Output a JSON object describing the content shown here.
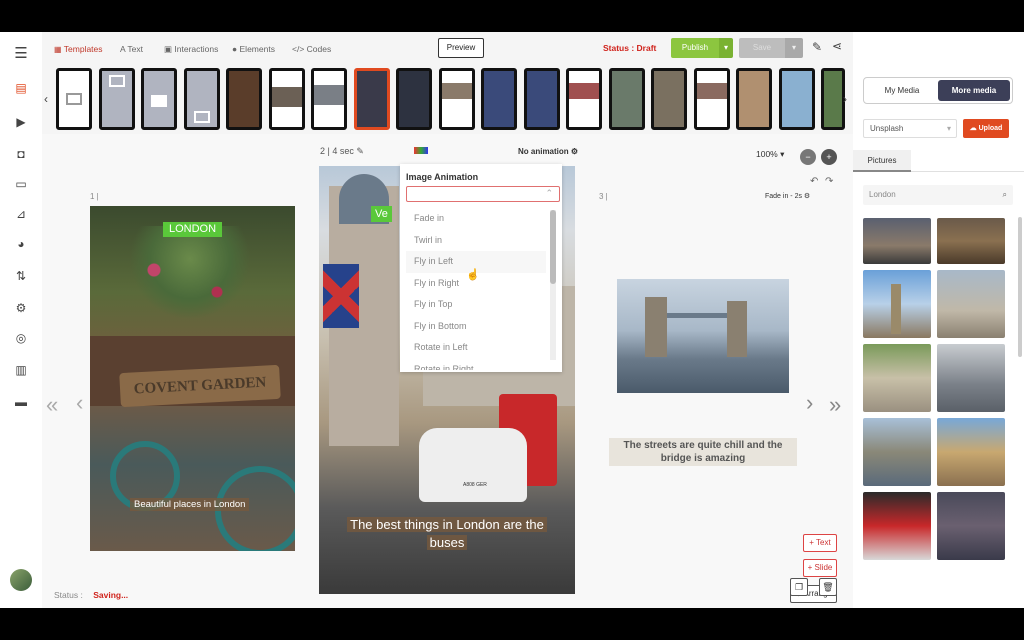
{
  "tabs": {
    "templates": "Templates",
    "text": "Text",
    "interactions": "Interactions",
    "elements": "Elements",
    "codes": "Codes"
  },
  "toolbar": {
    "preview": "Preview",
    "status": "Status : Draft",
    "publish": "Publish",
    "save": "Save"
  },
  "editor": {
    "slide_info": "2 |  4 sec",
    "no_animation": "No animation",
    "zoom": "100%",
    "slide1_num": "1 |",
    "slide3_num": "3 |",
    "slide3_anim": "Fade in - 2s"
  },
  "dropdown": {
    "title": "Image Animation",
    "options": [
      "Fade in",
      "Twirl in",
      "Fly in Left",
      "Fly in Right",
      "Fly in Top",
      "Fly in Bottom",
      "Rotate in Left",
      "Rotate in Right"
    ]
  },
  "slides": {
    "s1_label": "LONDON",
    "s1_sign": "COVENT GARDEN",
    "s1_caption": "Beautiful places in London",
    "s2_label": "Ve",
    "s2_caption": "The best things in London are the buses",
    "s2_plate": "A808 GER",
    "s3_caption": "The streets are quite chill and the bridge is amazing"
  },
  "actions": {
    "text": "Text",
    "slide": "Slide",
    "arrange": "Arrange"
  },
  "footer": {
    "status_label": "Status :",
    "status_value": "Saving..."
  },
  "media": {
    "my_media": "My Media",
    "more_media": "More media",
    "source": "Unsplash",
    "upload": "Upload",
    "pictures": "Pictures",
    "search_value": "London"
  },
  "colors": {
    "accent": "#e04a20",
    "publish": "#8cc63f",
    "green_label": "#5ac83a",
    "more_media_bg": "#3c3f58"
  }
}
